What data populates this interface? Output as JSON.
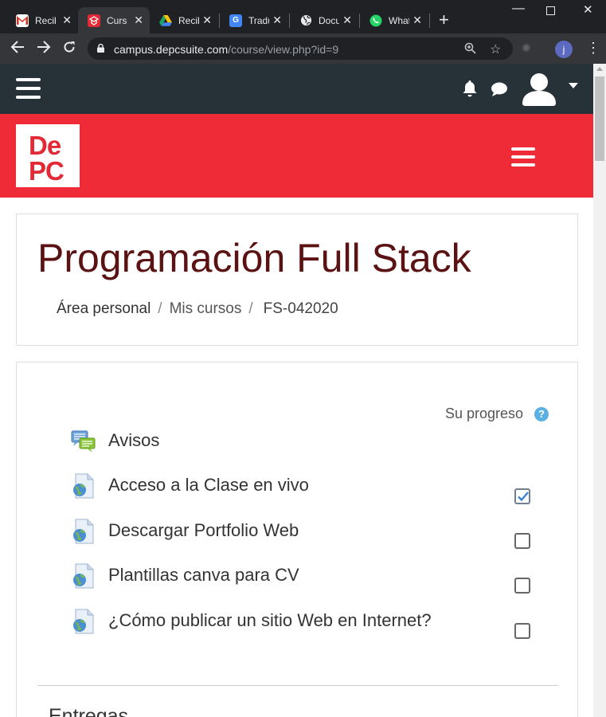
{
  "browser": {
    "tabs": [
      {
        "title": "Recibidos",
        "icon": "gmail-icon",
        "color": "#d93025"
      },
      {
        "title": "Curso",
        "icon": "depc-favicon-icon",
        "color": "#e32935"
      },
      {
        "title": "Recibidos",
        "icon": "google-drive-icon",
        "color": "#1fa463"
      },
      {
        "title": "Traductor",
        "icon": "google-translate-icon",
        "color": "#4285f4"
      },
      {
        "title": "Documentos",
        "icon": "globe-icon",
        "color": "#e8eaed"
      },
      {
        "title": "WhatsApp",
        "icon": "whatsapp-icon",
        "color": "#25d366"
      }
    ],
    "url_host": "campus.depcsuite.com",
    "url_path": "/course/view.php?id=9",
    "profile_initial": "j"
  },
  "site": {
    "logo_line1": "De",
    "logo_line2": "PC",
    "brand_color": "#ef2b38",
    "nav_color": "#263238"
  },
  "course": {
    "title": "Programación Full Stack",
    "breadcrumb": {
      "home": "Área personal",
      "my_courses": "Mis cursos",
      "separator": "/",
      "current": "FS-042020"
    }
  },
  "progress_label": "Su progreso",
  "help_glyph": "?",
  "activities": [
    {
      "label": "Avisos",
      "icon": "forum-icon",
      "has_checkbox": false,
      "completed": false
    },
    {
      "label": "Acceso a la Clase en vivo",
      "icon": "url-resource-icon",
      "has_checkbox": true,
      "completed": true
    },
    {
      "label": "Descargar Portfolio Web",
      "icon": "url-resource-icon",
      "has_checkbox": true,
      "completed": false
    },
    {
      "label": "Plantillas canva para CV",
      "icon": "url-resource-icon",
      "has_checkbox": true,
      "completed": false
    },
    {
      "label": "¿Cómo publicar un sitio Web en Internet?",
      "icon": "url-resource-icon",
      "has_checkbox": true,
      "completed": false
    }
  ],
  "next_section": "Entregas"
}
